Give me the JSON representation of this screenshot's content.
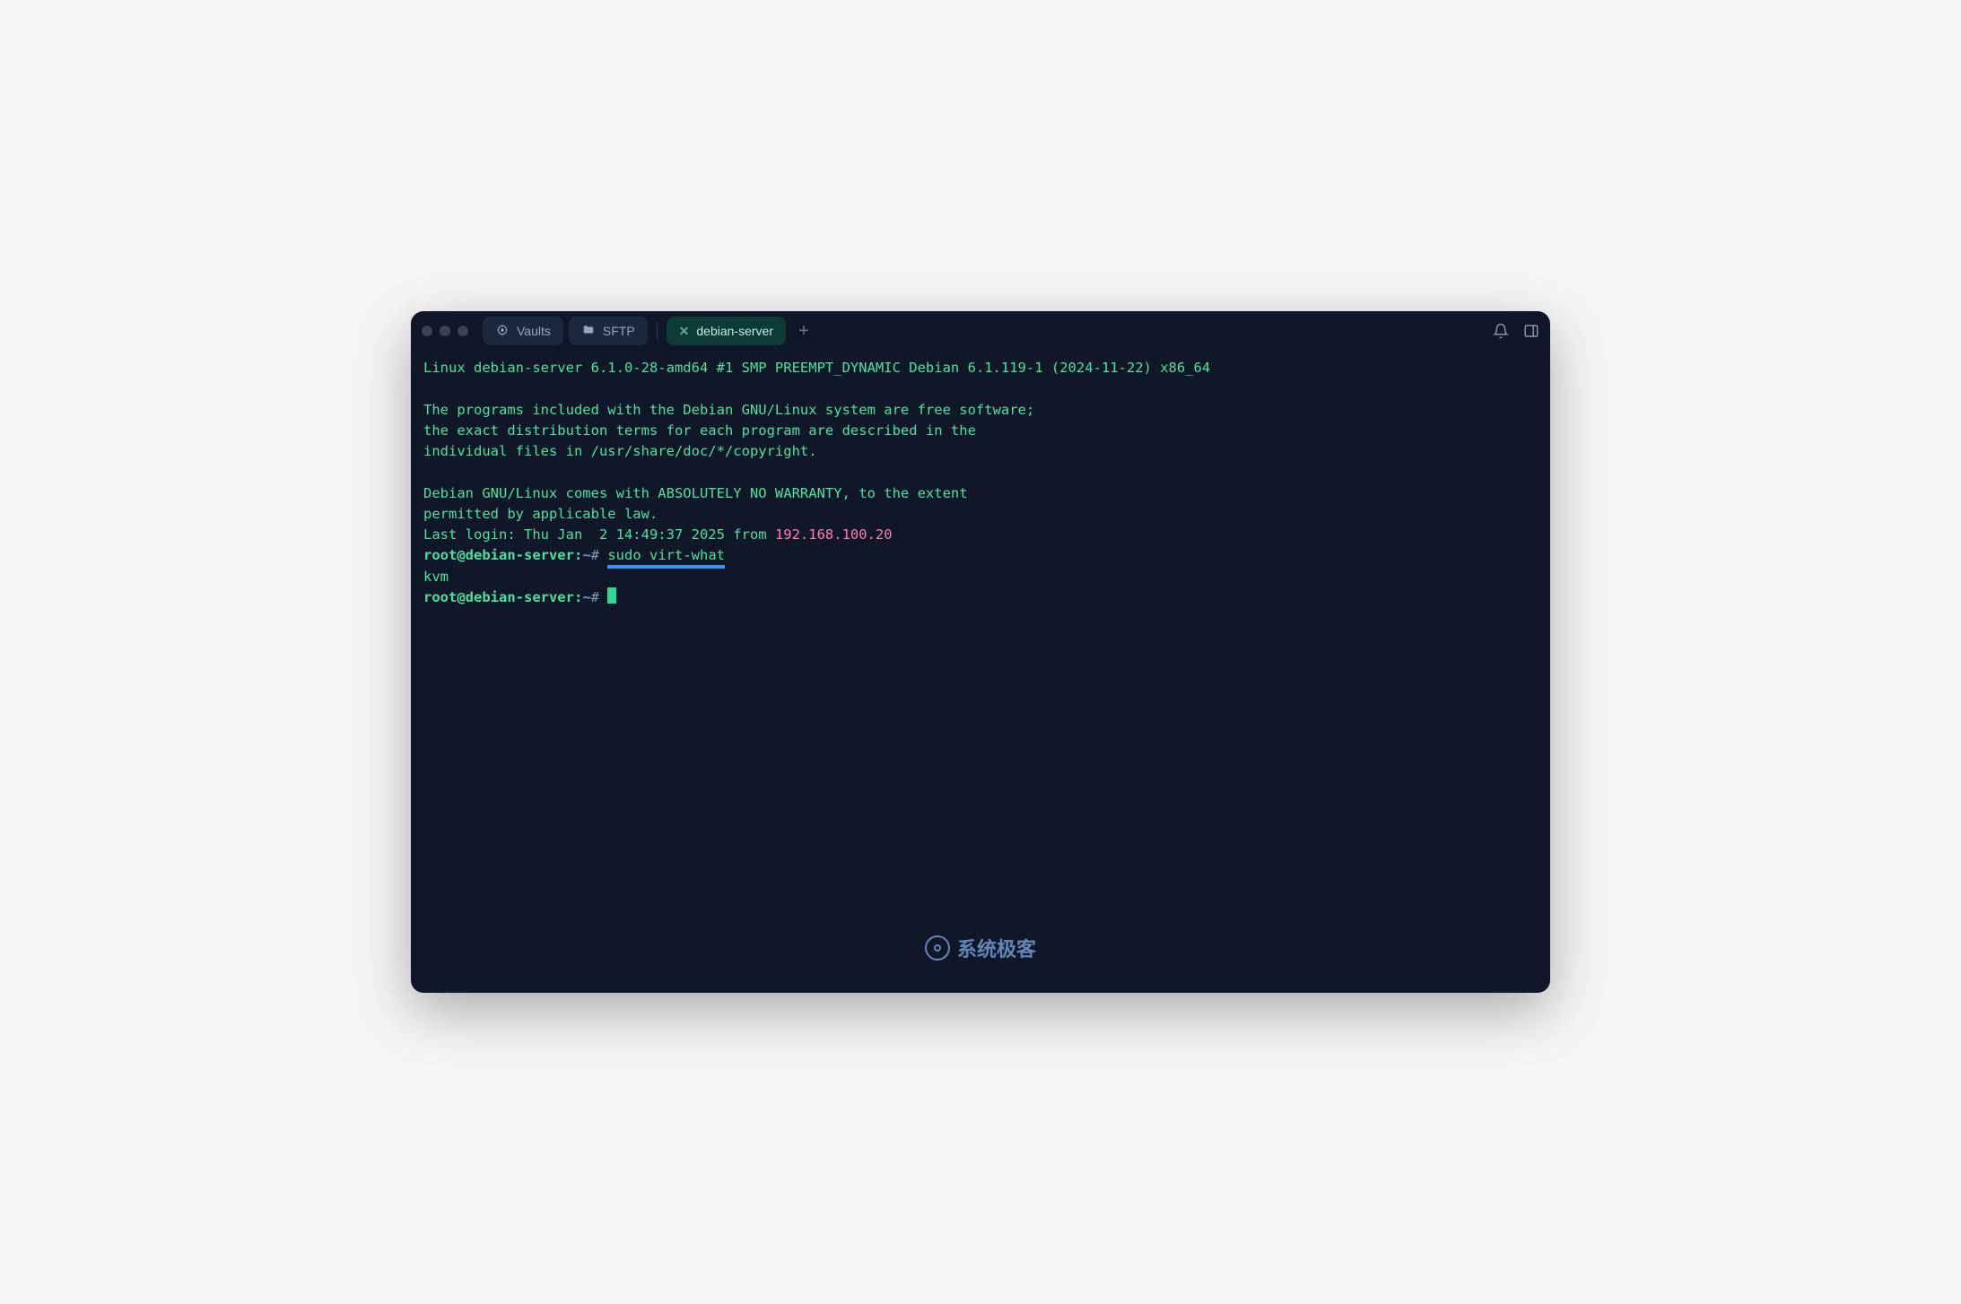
{
  "tabs": [
    {
      "label": "Vaults",
      "icon": "vaults"
    },
    {
      "label": "SFTP",
      "icon": "folder"
    },
    {
      "label": "debian-server",
      "icon": "close",
      "active": true
    }
  ],
  "terminal": {
    "motd_line1": "Linux debian-server 6.1.0-28-amd64 #1 SMP PREEMPT_DYNAMIC Debian 6.1.119-1 (2024-11-22) x86_64",
    "motd_line2": "The programs included with the Debian GNU/Linux system are free software;",
    "motd_line3": "the exact distribution terms for each program are described in the",
    "motd_line4": "individual files in /usr/share/doc/*/copyright.",
    "motd_line5": "Debian GNU/Linux comes with ABSOLUTELY NO WARRANTY, to the extent",
    "motd_line6": "permitted by applicable law.",
    "last_login_prefix": "Last login: Thu Jan  2 14:49:37 2025 from ",
    "last_login_ip": "192.168.100.20",
    "prompt_user": "root@debian-server",
    "prompt_sep": ":",
    "prompt_path": "~",
    "prompt_hash": "# ",
    "command1": "sudo virt-what",
    "output1": "kvm"
  },
  "watermark": {
    "text": "系统极客"
  },
  "colors": {
    "bg": "#0f1729",
    "green": "#4ce19f",
    "pink": "#ff7bb0",
    "underline": "#3b95f0"
  }
}
